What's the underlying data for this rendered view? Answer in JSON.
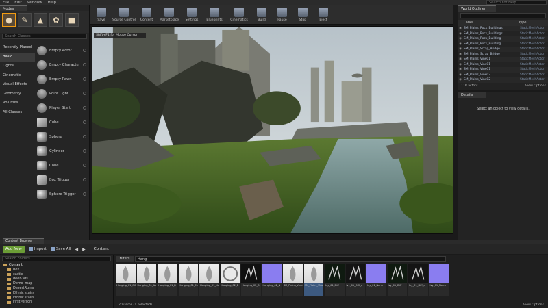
{
  "menu": [
    "File",
    "Edit",
    "Window",
    "Help"
  ],
  "search_assets_placeholder": "Search For Help",
  "modes": {
    "tab": "Modes",
    "search_placeholder": "Search Classes",
    "categories": [
      "Recently Placed",
      "Basic",
      "Lights",
      "Cinematic",
      "Visual Effects",
      "Geometry",
      "Volumes",
      "All Classes"
    ],
    "active_category": 1,
    "placeables": [
      {
        "label": "Empty Actor",
        "shape": "actor"
      },
      {
        "label": "Empty Character",
        "shape": "actor"
      },
      {
        "label": "Empty Pawn",
        "shape": "actor"
      },
      {
        "label": "Point Light",
        "shape": "actor"
      },
      {
        "label": "Player Start",
        "shape": "actor"
      },
      {
        "label": "Cube",
        "shape": "box"
      },
      {
        "label": "Sphere",
        "shape": "sphere"
      },
      {
        "label": "Cylinder",
        "shape": "sphere"
      },
      {
        "label": "Cone",
        "shape": "sphere"
      },
      {
        "label": "Box Trigger",
        "shape": "box"
      },
      {
        "label": "Sphere Trigger",
        "shape": "sphere"
      }
    ]
  },
  "toolbar": [
    {
      "label": "Save"
    },
    {
      "label": "Source Control"
    },
    {
      "label": "Content"
    },
    {
      "label": "Marketplace"
    },
    {
      "label": "Settings"
    },
    {
      "label": "Blueprints"
    },
    {
      "label": "Cinematics"
    },
    {
      "label": "Build"
    },
    {
      "label": "Pause"
    },
    {
      "label": "Stop"
    },
    {
      "label": "Eject"
    }
  ],
  "viewport": {
    "overlay": "Shift+F1 for Mouse Cursor"
  },
  "outliner": {
    "tab": "World Outliner",
    "search_placeholder": "",
    "col_label": "Label",
    "col_type": "Type",
    "rows": [
      {
        "label": "SM_Plains_Rock_Buildings",
        "type": "StaticMeshActor"
      },
      {
        "label": "SM_Plains_Rock_Buildings",
        "type": "StaticMeshActor"
      },
      {
        "label": "SM_Plains_Rock_Building",
        "type": "StaticMeshActor"
      },
      {
        "label": "SM_Plains_Rock_Building",
        "type": "StaticMeshActor"
      },
      {
        "label": "SM_Plains_Scrap_Bridge",
        "type": "StaticMeshActor"
      },
      {
        "label": "SM_Plains_Scrap_Bridge",
        "type": "StaticMeshActor"
      },
      {
        "label": "SM_Plains_Vine01",
        "type": "StaticMeshActor"
      },
      {
        "label": "SM_Plains_Vine01",
        "type": "StaticMeshActor"
      },
      {
        "label": "SM_Plains_Vine01",
        "type": "StaticMeshActor"
      },
      {
        "label": "SM_Plains_Vine02",
        "type": "StaticMeshActor"
      },
      {
        "label": "SM_Plains_Vine02",
        "type": "StaticMeshActor"
      }
    ],
    "actor_count": "118 actors",
    "view_options": "View Options"
  },
  "details": {
    "tab": "Details",
    "message": "Select an object to view details."
  },
  "content_browser": {
    "tab": "Content Browser",
    "add_new": "Add New",
    "import": "Import",
    "save_all": "Save All",
    "path": "Content",
    "folder_search_placeholder": "Search Folders",
    "folders": [
      "Content",
      "Box",
      "castle",
      "deer-3ds",
      "Demo_map",
      "DesertRuins",
      "Ethnic stairs",
      "Ethnic stairs",
      "FirstPerson"
    ],
    "filters_label": "Filters",
    "search_value": "Hang",
    "tiles": [
      {
        "name": "Hanging_01_GiP",
        "color": "#d8d8d8",
        "kind": "plant"
      },
      {
        "name": "Hanging_01_Aba",
        "color": "#d8d8d8",
        "kind": "plant"
      },
      {
        "name": "Hanging_01_D",
        "color": "#d8d8d8",
        "kind": "plant"
      },
      {
        "name": "Hanging_01_Mn",
        "color": "#d8d8d8",
        "kind": "plant"
      },
      {
        "name": "Hanging_01_Noise",
        "color": "#d8d8d8",
        "kind": "plant"
      },
      {
        "name": "Hanging_02_D",
        "color": "#e8e8e8",
        "kind": "round"
      },
      {
        "name": "Hanging_02_B",
        "color": "#111111",
        "kind": "dark"
      },
      {
        "name": "Hanging_02_N",
        "color": "#8a7df0",
        "kind": "flat"
      },
      {
        "name": "SM_Plains_Vine01",
        "color": "#d8d8d8",
        "kind": "plant"
      },
      {
        "name": "SM_Plains_Vine02",
        "color": "#d8d8d8",
        "kind": "plant"
      },
      {
        "name": "Ivy_01_Diff",
        "color": "#0f1a10",
        "kind": "dark"
      },
      {
        "name": "Ivy_01_Diff_a",
        "color": "#141414",
        "kind": "dark"
      },
      {
        "name": "Ivy_01_Norm",
        "color": "#8a7df0",
        "kind": "flat"
      },
      {
        "name": "Ivy_01_Diff",
        "color": "#0f1a10",
        "kind": "dark"
      },
      {
        "name": "Ivy_01_Diff_a",
        "color": "#141414",
        "kind": "dark"
      },
      {
        "name": "Ivy_01_Norm",
        "color": "#8a7df0",
        "kind": "flat"
      }
    ],
    "selected_tile": 9,
    "items_count": "20 items (1 selected)",
    "view_options": "View Options"
  }
}
